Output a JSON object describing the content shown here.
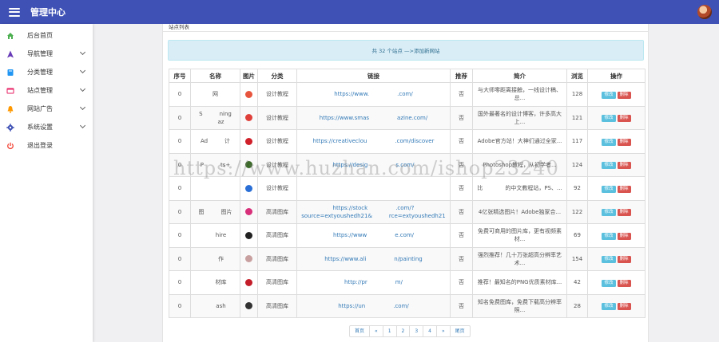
{
  "header": {
    "title": "管理中心"
  },
  "sidebar": {
    "items": [
      {
        "label": "后台首页",
        "icon": "home-icon",
        "color": "#4caf50",
        "has_submenu": false
      },
      {
        "label": "导航管理",
        "icon": "navigation-icon",
        "color": "#673ab7",
        "has_submenu": true
      },
      {
        "label": "分类管理",
        "icon": "folder-icon",
        "color": "#2196f3",
        "has_submenu": true
      },
      {
        "label": "站点管理",
        "icon": "site-icon",
        "color": "#e91e63",
        "has_submenu": true
      },
      {
        "label": "网站广告",
        "icon": "bell-icon",
        "color": "#ff9800",
        "has_submenu": true
      },
      {
        "label": "系统设置",
        "icon": "gear-icon",
        "color": "#3f51b5",
        "has_submenu": true
      },
      {
        "label": "退出登录",
        "icon": "power-icon",
        "color": "#f44336",
        "has_submenu": false
      }
    ]
  },
  "panel": {
    "title": "站点列表",
    "info_prefix": "共 32 个站点 —> ",
    "info_link": "添加新网站"
  },
  "table": {
    "headers": [
      "序号",
      "名称",
      "图片",
      "分类",
      "链接",
      "推荐",
      "简介",
      "浏览",
      "操作"
    ],
    "rows": [
      {
        "no": "0",
        "name": "网",
        "pic_color": "#e8553e",
        "category": "设计教程",
        "link": "https://www.　　　　　.com/",
        "recommend": "否",
        "intro": "与大师零距离接触，一线设计稿、总...",
        "views": "128"
      },
      {
        "no": "0",
        "name": "S　　　ning 　　az",
        "pic_color": "#e0403a",
        "category": "设计教程",
        "link": "https://www.smas　　　　　azine.com/",
        "recommend": "否",
        "intro": "国外最著名的设计博客，许多高大上...",
        "views": "121"
      },
      {
        "no": "0",
        "name": "Ad　　　计",
        "pic_color": "#d0202a",
        "category": "设计教程",
        "link": "https://creativeclou　　　　　.com/discover",
        "recommend": "否",
        "intro": "Adobe官方站！大神们通过全家...",
        "views": "117"
      },
      {
        "no": "0",
        "name": "P　　　ts+",
        "pic_color": "#3d6b2a",
        "category": "设计教程",
        "link": "https://desig　　　　　s.com/",
        "recommend": "否",
        "intro": "Photoshop教程，从初学者...",
        "views": "124"
      },
      {
        "no": "0",
        "name": "　　　",
        "pic_color": "#2a6fd6",
        "category": "设计教程",
        "link": "",
        "recommend": "否",
        "intro": "比　　　　的中文教程站，PS、...",
        "views": "92"
      },
      {
        "no": "0",
        "name": "图　　　图片",
        "pic_color": "#d8307a",
        "category": "高清图库",
        "link": "https://stock　　　　　.com/?source=extyoushedh21&　　　rce=extyoushedh21",
        "recommend": "否",
        "intro": "4亿张精选图片！Adobe独家合...",
        "views": "122"
      },
      {
        "no": "0",
        "name": "　　hire",
        "pic_color": "#222222",
        "category": "高清图库",
        "link": "https://www　　　　　e.com/",
        "recommend": "否",
        "intro": "免费可商用的图片库，更有视频素材...",
        "views": "69"
      },
      {
        "no": "0",
        "name": "　　作",
        "pic_color": "#c9a0a0",
        "category": "高清图库",
        "link": "https://www.ali　　　　　n/painting",
        "recommend": "否",
        "intro": "强烈推荐！几十万张超高分辨率艺术...",
        "views": "154"
      },
      {
        "no": "0",
        "name": "　　材库",
        "pic_color": "#c41e2a",
        "category": "高清图库",
        "link": "http://pr　　　　　m/",
        "recommend": "否",
        "intro": "推荐！最知名的PNG优质素材库...",
        "views": "42"
      },
      {
        "no": "0",
        "name": "　　ash",
        "pic_color": "#333333",
        "category": "高清图库",
        "link": "https://un　　　　　.com/",
        "recommend": "否",
        "intro": "知名免费图库，免费下载高分辨率照...",
        "views": "28"
      }
    ],
    "edit_label": "修改",
    "delete_label": "删除"
  },
  "pagination": {
    "first": "首页",
    "prev": "«",
    "pages": [
      "1",
      "2",
      "3",
      "4"
    ],
    "next": "»",
    "last": "尾页"
  },
  "watermark": "https://www.huzhan.com/ishop23240"
}
